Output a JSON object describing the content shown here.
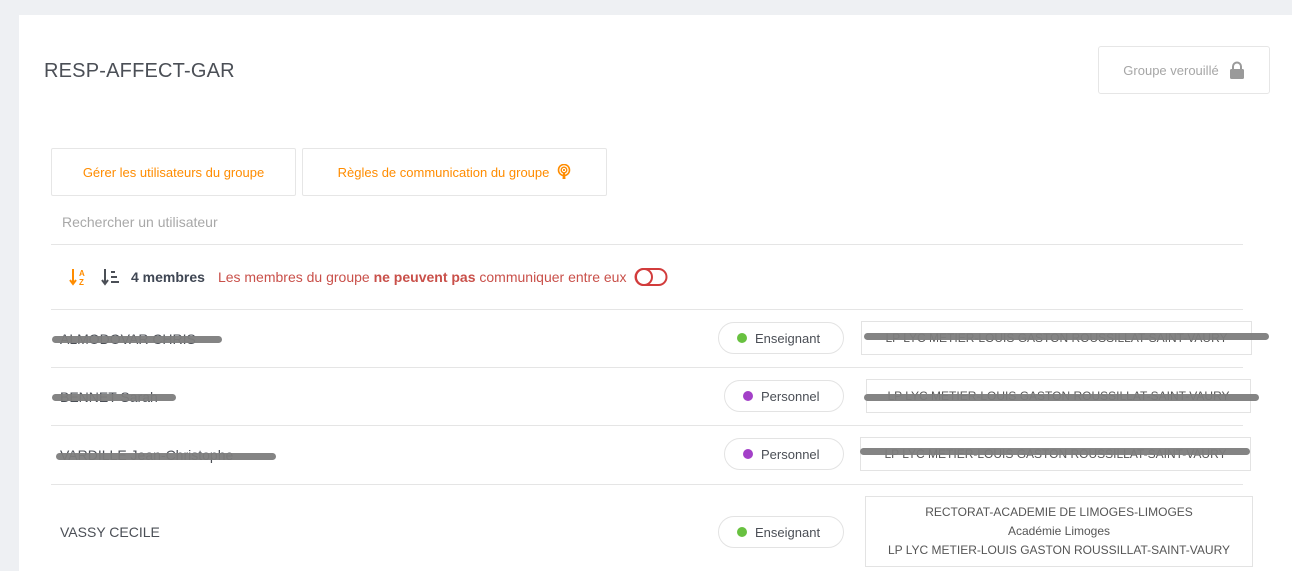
{
  "group": {
    "title": "RESP-AFFECT-GAR",
    "lock_label": "Groupe verouillé"
  },
  "actions": {
    "manage_users": "Gérer les utilisateurs du groupe",
    "comm_rules": "Règles de communication du groupe"
  },
  "search": {
    "placeholder": "Rechercher un utilisateur"
  },
  "members_bar": {
    "count_label": "4 membres",
    "comm_prefix": "Les membres du groupe ",
    "comm_bold": "ne peuvent pas",
    "comm_suffix": " communiquer entre eux"
  },
  "colors": {
    "accent": "#ff8c00",
    "danger": "#c9504a",
    "teacher_dot": "#68c140",
    "staff_dot": "#a340c8"
  },
  "members": [
    {
      "name": "ALMODOVAR CHRIS",
      "profile": "Enseignant",
      "structures": [
        "LP LYC METIER-LOUIS GASTON ROUSSILLAT-SAINT-VAURY"
      ],
      "redacted": true
    },
    {
      "name": "BENNET Sarah",
      "profile": "Personnel",
      "structures": [
        "LP LYC METIER-LOUIS GASTON ROUSSILLAT-SAINT-VAURY"
      ],
      "redacted": true
    },
    {
      "name": "VARDILLE Jean-Christophe",
      "profile": "Personnel",
      "structures": [
        "LP LYC METIER-LOUIS GASTON ROUSSILLAT-SAINT-VAURY"
      ],
      "redacted": true
    },
    {
      "name": "VASSY CECILE",
      "profile": "Enseignant",
      "structures": [
        "RECTORAT-ACADEMIE DE LIMOGES-LIMOGES",
        "Académie Limoges",
        "LP LYC METIER-LOUIS GASTON ROUSSILLAT-SAINT-VAURY"
      ],
      "redacted": false
    }
  ]
}
